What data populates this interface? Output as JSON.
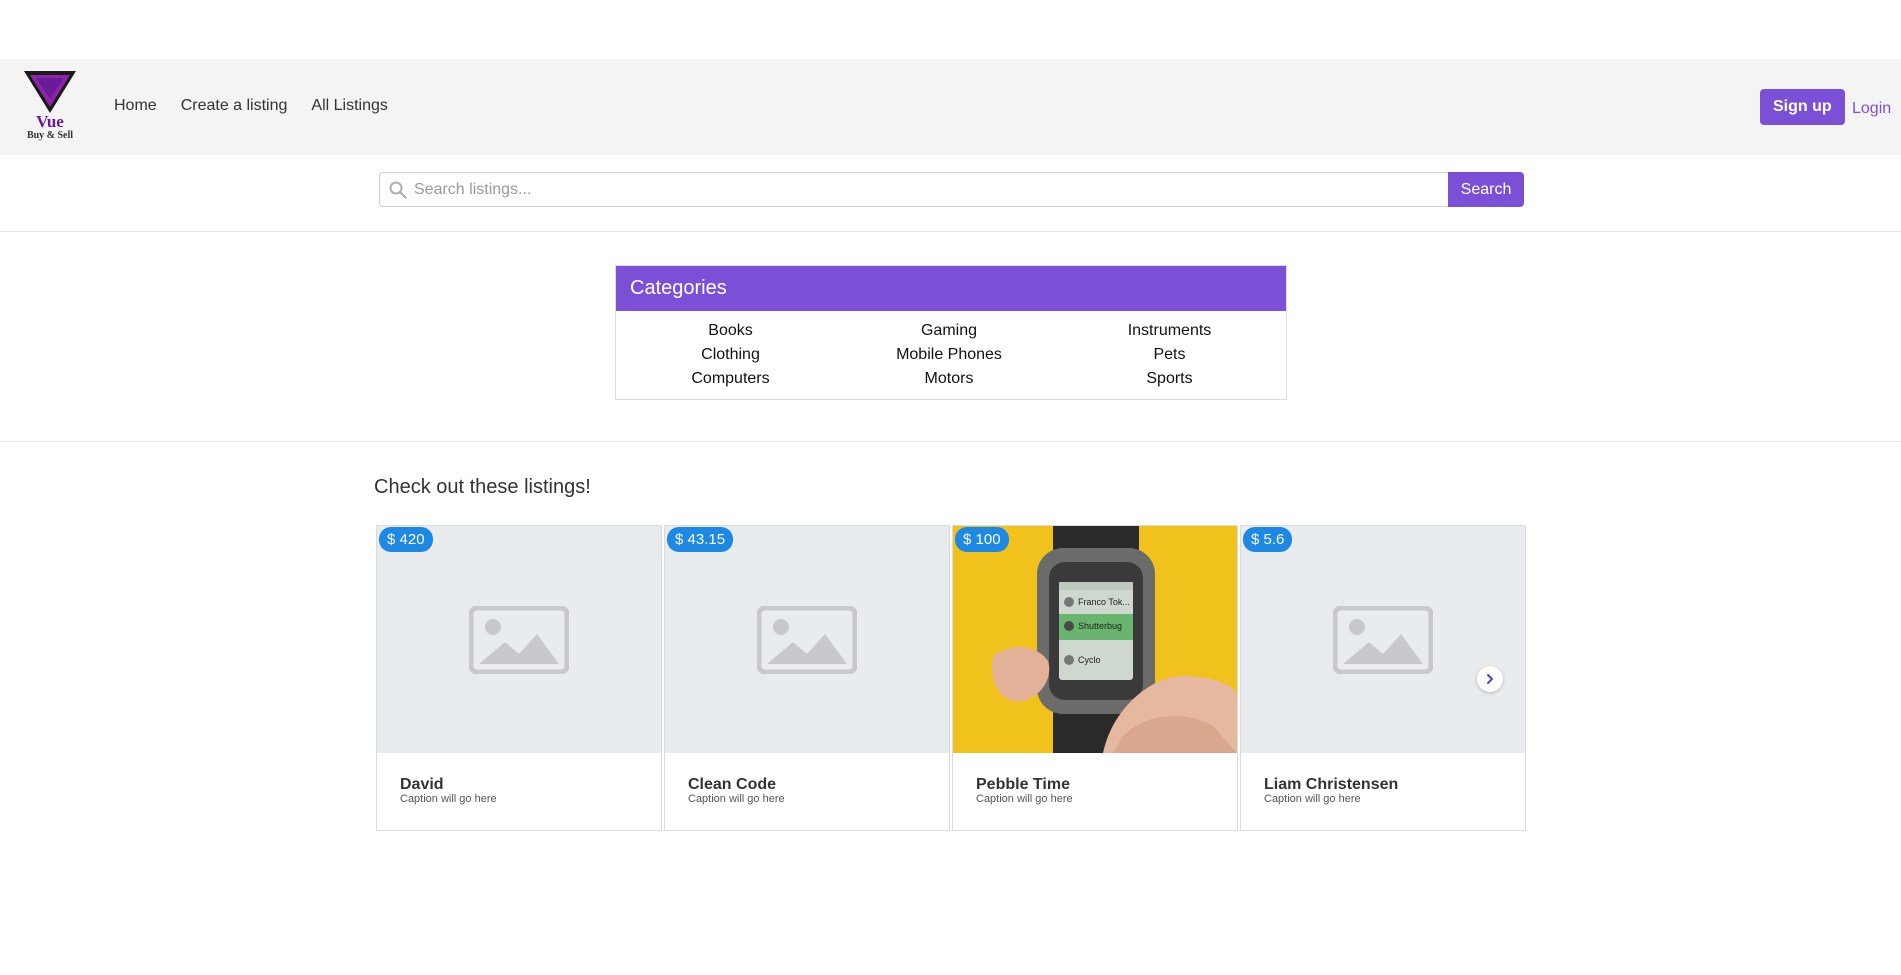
{
  "header": {
    "logo_text": "Vue",
    "logo_sub": "Buy & Sell",
    "nav": [
      "Home",
      "Create a listing",
      "All Listings"
    ],
    "signup_label": "Sign up",
    "login_label": "Login"
  },
  "search": {
    "placeholder": "Search listings...",
    "button_label": "Search"
  },
  "categories": {
    "title": "Categories",
    "items": [
      "Books",
      "Gaming",
      "Instruments",
      "Clothing",
      "Mobile Phones",
      "Pets",
      "Computers",
      "Motors",
      "Sports"
    ]
  },
  "listings": {
    "title": "Check out these listings!",
    "cards": [
      {
        "price": "$ 420",
        "name": "David",
        "caption": "Caption will go here",
        "image": "placeholder"
      },
      {
        "price": "$ 43.15",
        "name": "Clean Code",
        "caption": "Caption will go here",
        "image": "placeholder"
      },
      {
        "price": "$ 100",
        "name": "Pebble Time",
        "caption": "Caption will go here",
        "image": "smartwatch-photo",
        "watch_screen": [
          "Franco Tok...",
          "Shutterbug",
          "Cyclo"
        ]
      },
      {
        "price": "$ 5.6",
        "name": "Liam Christensen",
        "caption": "Caption will go here",
        "image": "placeholder"
      }
    ]
  },
  "colors": {
    "accent": "#7b4fd6",
    "price_badge": "#1e88e5",
    "header_bg": "#f4f4f4"
  }
}
